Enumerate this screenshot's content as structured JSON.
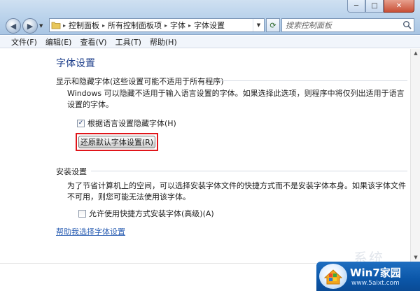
{
  "window": {
    "controls": {
      "minimize": "─",
      "maximize": "□",
      "close": "✕"
    }
  },
  "navigation": {
    "back_glyph": "◀",
    "forward_glyph": "▶",
    "dropdown_glyph": "▼",
    "refresh_glyph": "⟳"
  },
  "breadcrumb": [
    "控制面板",
    "所有控制面板项",
    "字体",
    "字体设置"
  ],
  "search": {
    "placeholder": "搜索控制面板"
  },
  "menu": [
    "文件(F)",
    "编辑(E)",
    "查看(V)",
    "工具(T)",
    "帮助(H)"
  ],
  "page": {
    "title": "字体设置",
    "section1": {
      "heading": "显示和隐藏字体(这些设置可能不适用于所有程序)",
      "description_line1": "Windows 可以隐藏不适用于输入语言设置的字体。如果选择此选项，则程序中将仅列出适用于语言",
      "description_line2": "设置的字体。",
      "checkbox_label": "根据语言设置隐藏字体(H)",
      "checkbox_checked": true,
      "checkbox_glyph": "✓",
      "button_label": "还原默认字体设置(R)"
    },
    "section2": {
      "heading": "安装设置",
      "description_line1": "为了节省计算机上的空间，可以选择安装字体文件的快捷方式而不是安装字体本身。如果该字体文件",
      "description_line2": "不可用，则您可能无法使用该字体。",
      "checkbox_label": "允许使用快捷方式安装字体(高级)(A)",
      "checkbox_checked": false
    },
    "help_link": "帮助我选择字体设置"
  },
  "watermark": {
    "brand": "Win7家园",
    "url": "www.5aixt.com",
    "ghost_text": "系统"
  },
  "colors": {
    "highlight_border": "#e0151a",
    "title_text": "#1e3f8b",
    "link": "#2c5fb3"
  }
}
